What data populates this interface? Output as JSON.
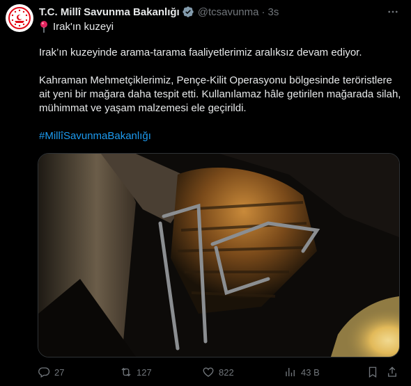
{
  "tweet": {
    "display_name": "T.C. Millî Savunma Bakanlığı",
    "handle": "@tcsavunma",
    "separator": "·",
    "time": "3s",
    "location_icon": "pin-icon",
    "location_text": "Irak'ın kuzeyi",
    "paragraphs": [
      "Irak’ın kuzeyinde arama-tarama faaliyetlerimiz aralıksız devam ediyor.",
      "Kahraman Mehmetçiklerimiz, Pençe-Kilit Operasyonu bölgesinde teröristlere ait yeni bir mağara daha tespit etti. Kullanılamaz hâle getirilen mağarada silah, mühimmat ve yaşam malzemesi ele geçirildi."
    ],
    "hashtag": "#MillîSavunmaBakanlığı"
  },
  "actions": {
    "replies": "27",
    "retweets": "127",
    "likes": "822",
    "views": "43 B"
  },
  "colors": {
    "background": "#000000",
    "text": "#e7e9ea",
    "muted": "#71767b",
    "link": "#1d9bf0",
    "verified": "#829aab",
    "brand_red": "#e30a17"
  }
}
